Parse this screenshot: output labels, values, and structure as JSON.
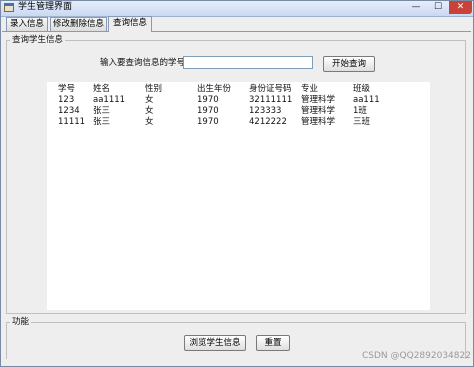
{
  "window": {
    "title": "学生管理界面",
    "controls": {
      "minimize": "—",
      "maximize": "☐",
      "close": "✕"
    }
  },
  "tabs": [
    {
      "label": "录入信息",
      "active": false
    },
    {
      "label": "修改删除信息",
      "active": false
    },
    {
      "label": "查询信息",
      "active": true
    }
  ],
  "query_panel": {
    "group_title": "查询学生信息",
    "input_label": "输入要查询信息的学号",
    "input_value": "",
    "search_button": "开始查询"
  },
  "results": {
    "columns": [
      "学号",
      "姓名",
      "性别",
      "出生年份",
      "身份证号码",
      "专业",
      "班级"
    ],
    "rows": [
      [
        "123",
        "aa1111",
        "女",
        "1970",
        "32111111",
        "管理科学",
        "aa111"
      ],
      [
        "1234",
        "张三",
        "女",
        "1970",
        "123333",
        "管理科学",
        "1班"
      ],
      [
        "11111",
        "张三",
        "女",
        "1970",
        "4212222",
        "管理科学",
        "三班"
      ]
    ]
  },
  "function_panel": {
    "group_title": "功能",
    "browse_button": "浏览学生信息",
    "reset_button": "重置"
  },
  "watermark": "CSDN @QQ2892034822",
  "colors": {
    "title_bar": "#c9d8f1",
    "close_button": "#c8423a",
    "panel_bg": "#eeeeee"
  }
}
